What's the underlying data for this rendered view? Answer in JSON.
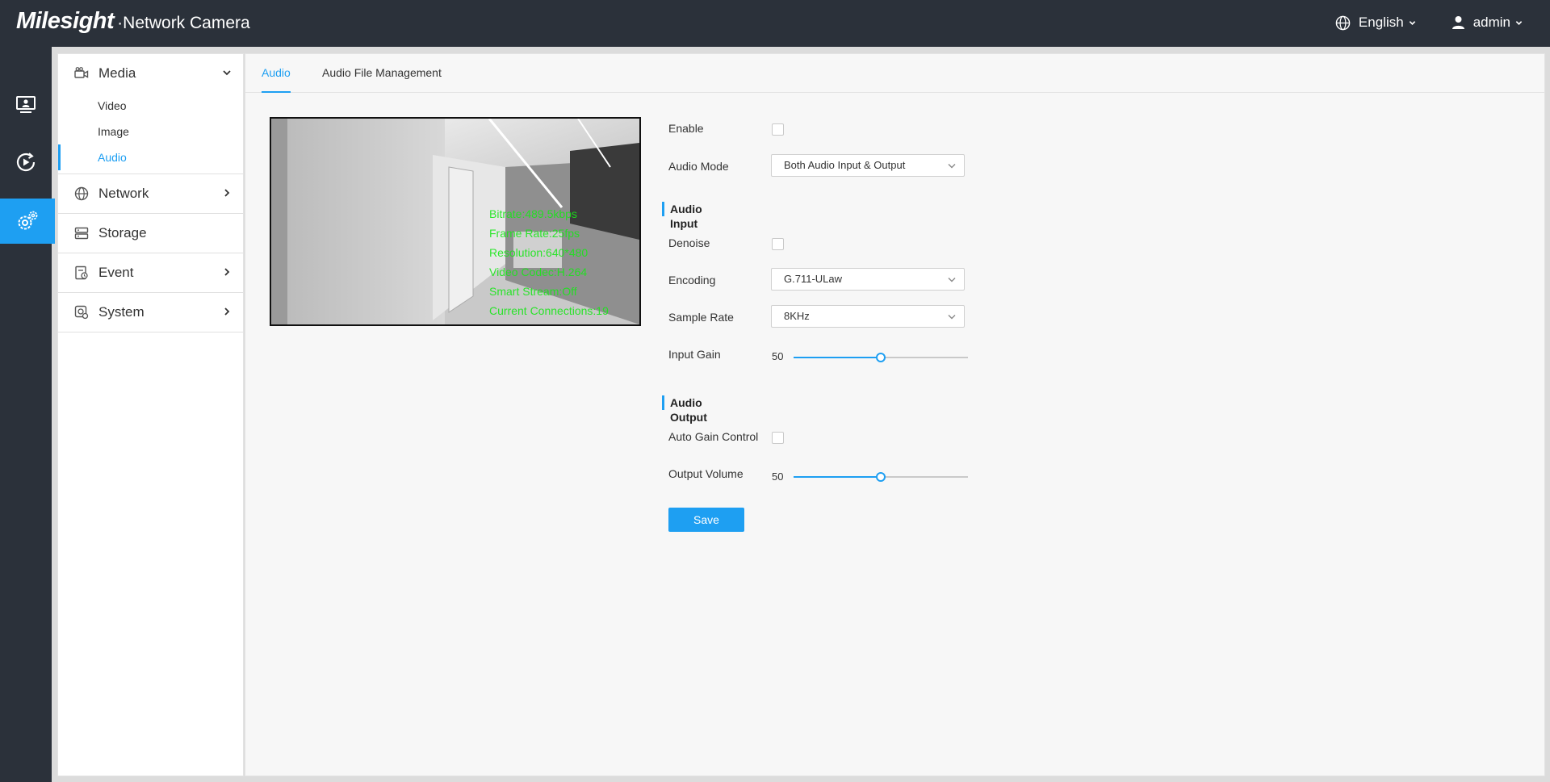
{
  "header": {
    "brand": "Milesight",
    "product": "·Network Camera",
    "language": "English",
    "user": "admin"
  },
  "rail": {
    "items": [
      {
        "icon": "live-view-icon"
      },
      {
        "icon": "playback-icon"
      },
      {
        "icon": "settings-icon",
        "active": true
      }
    ]
  },
  "menu": {
    "media": {
      "label": "Media",
      "items": [
        "Video",
        "Image",
        "Audio"
      ],
      "active": "Audio"
    },
    "network": "Network",
    "storage": "Storage",
    "event": "Event",
    "system": "System"
  },
  "tabs": [
    {
      "label": "Audio",
      "active": true
    },
    {
      "label": "Audio File Management",
      "active": false
    }
  ],
  "video": {
    "osd": [
      "Bitrate:489.5kbps",
      "Frame Rate:25fps",
      "Resolution:640*480",
      "Video Codec:H.264",
      "Smart Stream:Off",
      "Current Connections:19"
    ]
  },
  "form": {
    "enable": {
      "label": "Enable",
      "checked": false
    },
    "audio_mode": {
      "label": "Audio Mode",
      "value": "Both Audio Input & Output"
    },
    "input_section": "Audio Input",
    "denoise": {
      "label": "Denoise",
      "checked": false
    },
    "encoding": {
      "label": "Encoding",
      "value": "G.711-ULaw"
    },
    "sample_rate": {
      "label": "Sample Rate",
      "value": "8KHz"
    },
    "input_gain": {
      "label": "Input Gain",
      "value": "50",
      "fraction": 0.5
    },
    "output_section": "Audio Output",
    "auto_gain": {
      "label": "Auto Gain Control",
      "checked": false
    },
    "output_volume": {
      "label": "Output Volume",
      "value": "50",
      "fraction": 0.5
    },
    "save_label": "Save"
  },
  "colors": {
    "accent": "#1e9ff2",
    "header_bg": "#2b313a",
    "osd_text": "#19e619"
  }
}
